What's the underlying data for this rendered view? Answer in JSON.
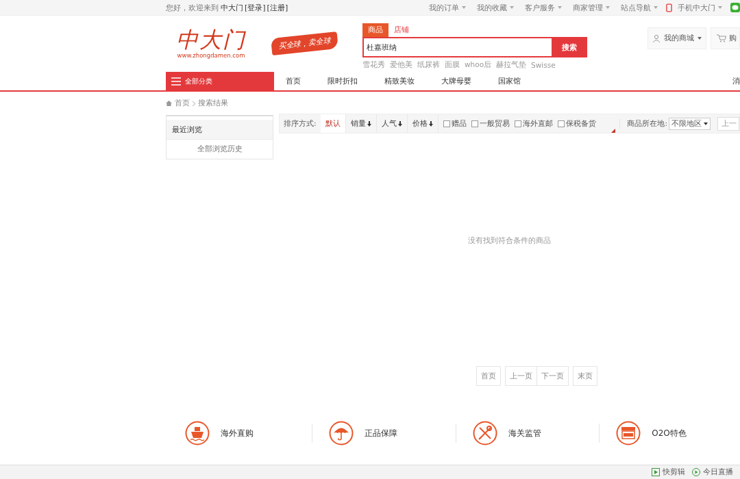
{
  "top_bar": {
    "greeting": "您好，欢迎来到",
    "site": "中大门",
    "login": "[登录]",
    "register": "[注册]",
    "links": [
      {
        "label": "我的订单"
      },
      {
        "label": "我的收藏"
      },
      {
        "label": "客户服务"
      },
      {
        "label": "商家管理"
      },
      {
        "label": "站点导航"
      }
    ],
    "mobile": "手机中大门"
  },
  "header": {
    "logo": "中大门",
    "logo_url": "www.zhongdamen.com",
    "slogan": "买全球，卖全球",
    "search_tabs": [
      {
        "label": "商品",
        "selected": true
      },
      {
        "label": "店铺",
        "selected": false
      }
    ],
    "search_value": "杜嘉班纳",
    "search_button": "搜索",
    "hot_words": [
      "雪花秀",
      "爱他美",
      "纸尿裤",
      "面膜",
      "whoo后",
      "赫拉气垫",
      "Swisse"
    ],
    "my_store": "我的商城",
    "cart": "购"
  },
  "nav": {
    "category": "全部分类",
    "items": [
      "首页",
      "限时折扣",
      "精致美妆",
      "大牌母婴",
      "国家馆"
    ],
    "cut_item": "消"
  },
  "breadcrumb": [
    "首页",
    "搜索结果"
  ],
  "sidebar": {
    "title": "最近浏览",
    "link": "全部浏览历史"
  },
  "sort_bar": {
    "label": "排序方式:",
    "options": [
      {
        "label": "默认",
        "selected": true,
        "arrow": false
      },
      {
        "label": "销量",
        "selected": false,
        "arrow": true
      },
      {
        "label": "人气",
        "selected": false,
        "arrow": true
      },
      {
        "label": "价格",
        "selected": false,
        "arrow": true
      }
    ],
    "filters": [
      {
        "label": "赠品",
        "checked": false
      },
      {
        "label": "一般贸易",
        "checked": false
      },
      {
        "label": "海外直邮",
        "checked": false
      },
      {
        "label": "保税备货",
        "checked": false
      }
    ],
    "location_label": "商品所在地:",
    "location_value": "不限地区",
    "prev_page": "上一"
  },
  "empty_message": "没有找到符合条件的商品",
  "pagination": [
    "首页",
    "上一页",
    "下一页",
    "末页"
  ],
  "features": [
    {
      "kind": "ship",
      "label": "海外直购"
    },
    {
      "kind": "umbrella",
      "label": "正品保障"
    },
    {
      "kind": "tools",
      "label": "海关监管"
    },
    {
      "kind": "shop",
      "label": "O2O特色"
    }
  ],
  "status_bar": {
    "items": [
      {
        "kind": "clip",
        "label": "快剪辑"
      },
      {
        "kind": "live",
        "label": "今日直播"
      }
    ]
  }
}
